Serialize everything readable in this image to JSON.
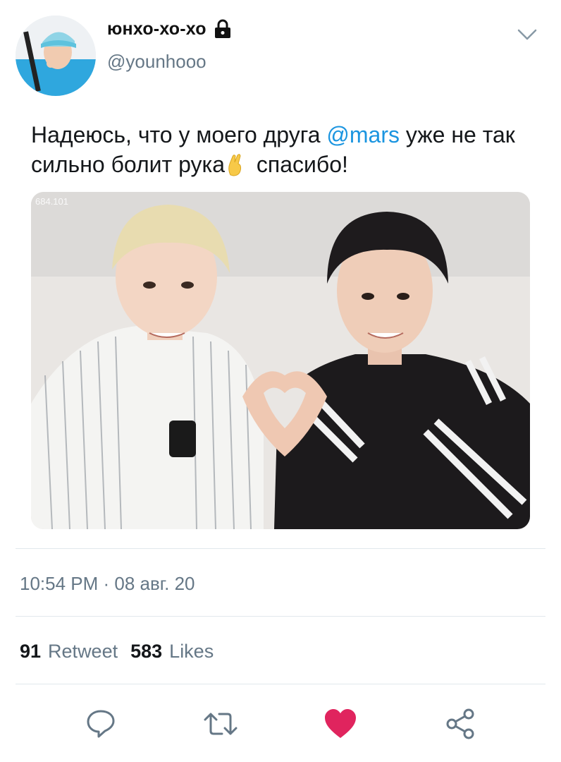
{
  "user": {
    "display_name": "юнхо-хо-хо",
    "handle": "@younhooo",
    "protected_icon": "lock-icon"
  },
  "tweet": {
    "text_before": "Надеюсь, что у моего друга ",
    "mention": "@mars",
    "text_after_mention": " уже не так сильно болит рука",
    "emoji": "crossed-fingers-emoji",
    "text_end": " спасибо!",
    "media_watermark": "684.101",
    "timestamp": "10:54 PM · 08 авг. 20"
  },
  "stats": {
    "retweets_count": "91",
    "retweets_label": "Retweet",
    "likes_count": "583",
    "likes_label": "Likes"
  },
  "actions": [
    {
      "name": "reply",
      "icon": "speech-bubble-icon"
    },
    {
      "name": "retweet",
      "icon": "retweet-icon"
    },
    {
      "name": "like",
      "icon": "heart-icon",
      "active": true
    },
    {
      "name": "share",
      "icon": "share-icon"
    }
  ],
  "colors": {
    "accent": "#1b95e0",
    "like_active": "#e0245e",
    "secondary_text": "#657786",
    "divider": "#e1e8ed"
  }
}
